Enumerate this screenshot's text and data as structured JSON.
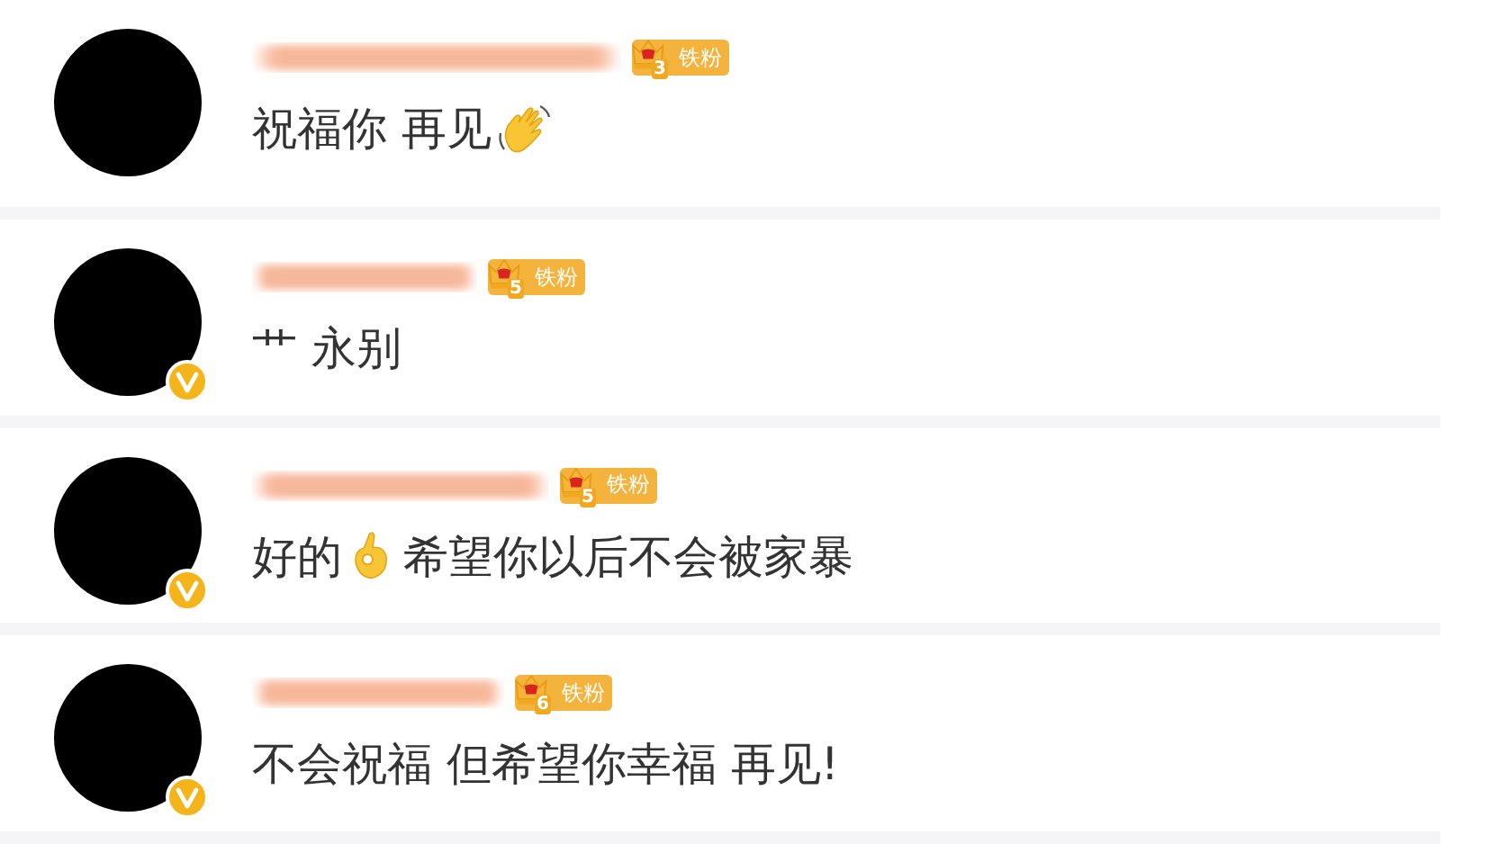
{
  "comments": [
    {
      "verified": false,
      "badge": {
        "level": "3",
        "label": "铁粉"
      },
      "message": [
        {
          "kind": "text",
          "text": "祝福你 再见"
        },
        {
          "kind": "wave"
        }
      ]
    },
    {
      "verified": true,
      "badge": {
        "level": "5",
        "label": "铁粉"
      },
      "message": [
        {
          "kind": "text",
          "text": "艹 永别"
        }
      ]
    },
    {
      "verified": true,
      "badge": {
        "level": "5",
        "label": "铁粉"
      },
      "message": [
        {
          "kind": "text",
          "text": "好的"
        },
        {
          "kind": "ok"
        },
        {
          "kind": "text",
          "text": "希望你以后不会被家暴"
        }
      ]
    },
    {
      "verified": true,
      "badge": {
        "level": "6",
        "label": "铁粉"
      },
      "message": [
        {
          "kind": "text",
          "text": "不会祝福 但希望你幸福 再见!"
        }
      ]
    }
  ]
}
